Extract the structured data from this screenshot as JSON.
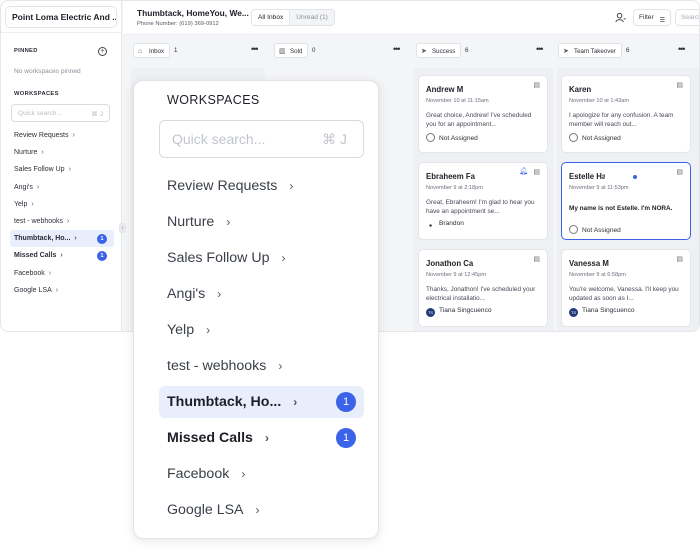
{
  "sidebar": {
    "company": "Point Loma Electric And ...",
    "pinned_label": "PINNED",
    "no_pinned": "No workspaces pinned",
    "workspaces_label": "WORKSPACES",
    "search_placeholder": "Quick search...",
    "search_shortcut": "⌘ J",
    "items": [
      {
        "label": "Review Requests"
      },
      {
        "label": "Nurture"
      },
      {
        "label": "Sales Follow Up"
      },
      {
        "label": "Angi's"
      },
      {
        "label": "Yelp"
      },
      {
        "label": "test - webhooks"
      },
      {
        "label": "Thumbtack, Ho...",
        "badge": "1",
        "active": true
      },
      {
        "label": "Missed Calls",
        "badge": "1",
        "bold": true
      },
      {
        "label": "Facebook"
      },
      {
        "label": "Google LSA"
      }
    ]
  },
  "header": {
    "title": "Thumbtack, HomeYou, We...",
    "phone": "Phone Number: (619) 369-0912",
    "tab_all": "All Inbox",
    "tab_unread": "Unread (1)",
    "filter": "Filter",
    "search": "Search"
  },
  "columns": [
    {
      "name": "Inbox",
      "count": "1",
      "icon": "inbox-icon"
    },
    {
      "name": "Sold",
      "count": "0",
      "icon": "chart-icon"
    },
    {
      "name": "Success",
      "count": "6",
      "icon": "send-icon"
    },
    {
      "name": "Team Takeover",
      "count": "6",
      "icon": "send-icon"
    }
  ],
  "cards": [
    {
      "name": "Andrew M",
      "date": "November 10 at 11:15am",
      "msg": "Great choice, Andrew! I've scheduled you for an appointment...",
      "assignee": "Not Assigned"
    },
    {
      "name": "Karen",
      "date": "November 10 at 1:43am",
      "msg": "I apologize for any confusion. A team member will reach out...",
      "assignee": "Not Assigned"
    },
    {
      "name": "Ebraheem Fa",
      "date": "November 9 at 2:18pm",
      "msg": "Great, Ebraheem! I'm glad to hear you have an appointment se...",
      "assignee": "Brandon"
    },
    {
      "name": "Estelle Ha",
      "date": "November 9 at 11:53pm",
      "msg": "My name is not Estelle. I'm NORA.",
      "assignee": "Not Assigned"
    },
    {
      "name": "Jonathon Ca",
      "date": "November 9 at 12:45pm",
      "msg": "Thanks, Jonathon! I've scheduled your electrical installatio...",
      "assignee": "Tiana Singcuenco",
      "avatar": "TS"
    },
    {
      "name": "Vanessa M",
      "date": "November 9 at 6:58pm",
      "msg": "You're welcome, Vanessa. I'll keep you updated as soon as I...",
      "assignee": "Tiana Singcuenco",
      "avatar": "TS"
    }
  ],
  "popup": {
    "title": "WORKSPACES",
    "search_placeholder": "Quick search...",
    "search_shortcut": "⌘ J",
    "items": [
      {
        "label": "Review Requests"
      },
      {
        "label": "Nurture"
      },
      {
        "label": "Sales Follow Up"
      },
      {
        "label": "Angi's"
      },
      {
        "label": "Yelp"
      },
      {
        "label": "test - webhooks"
      },
      {
        "label": "Thumbtack, Ho...",
        "badge": "1"
      },
      {
        "label": "Missed Calls",
        "badge": "1"
      },
      {
        "label": "Facebook"
      },
      {
        "label": "Google LSA"
      }
    ]
  },
  "colors": {
    "accent": "#3b63e8",
    "selected_bg": "#e8eefc",
    "board_bg": "#eef0f3"
  }
}
